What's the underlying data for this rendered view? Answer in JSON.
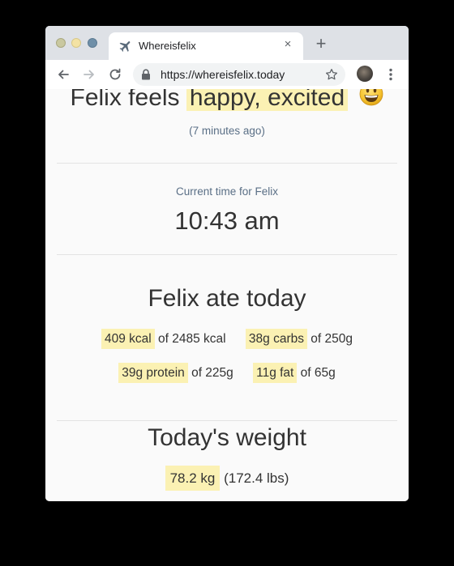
{
  "browser": {
    "tab": {
      "title": "Whereisfelix",
      "close_glyph": "×",
      "favicon": "airplane-icon"
    },
    "new_tab_glyph": "+",
    "url": "https://whereisfelix.today"
  },
  "mood": {
    "prefix": "Felix feels",
    "value": "happy, excited",
    "emoji": "grinning-face-icon",
    "ago": "(7 minutes ago)"
  },
  "time": {
    "label": "Current time for Felix",
    "value": "10:43 am"
  },
  "food": {
    "title": "Felix ate today",
    "stats": [
      {
        "value": "409 kcal",
        "suffix": "of 2485 kcal"
      },
      {
        "value": "38g carbs",
        "suffix": "of 250g"
      },
      {
        "value": "39g protein",
        "suffix": "of 225g"
      },
      {
        "value": "11g fat",
        "suffix": "of 65g"
      }
    ]
  },
  "weight": {
    "title": "Today's weight",
    "value": "78.2 kg",
    "imperial": "(172.4 lbs)"
  },
  "colors": {
    "highlight": "#fbf1b3",
    "muted_text": "#5a6f86",
    "body_text": "#333333"
  }
}
